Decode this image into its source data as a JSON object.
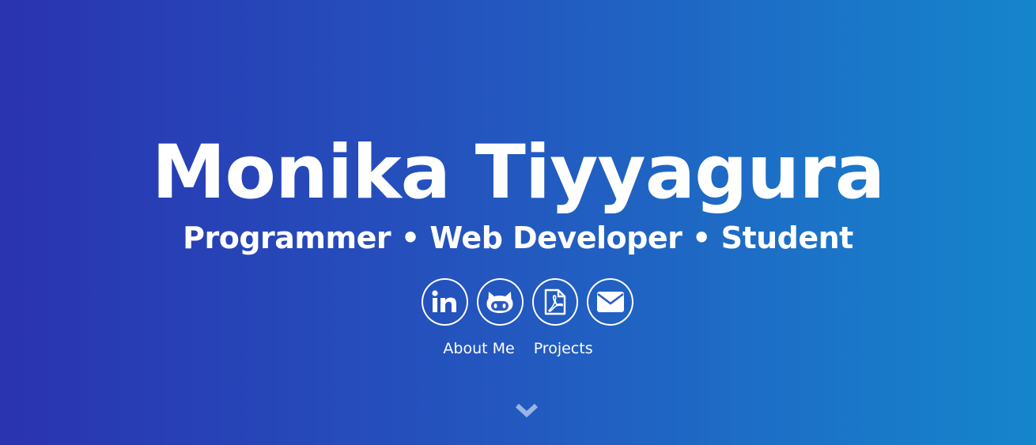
{
  "hero": {
    "name": "Monika Tiyyagura",
    "tagline": "Programmer • Web Developer • Student",
    "background_colors": [
      "#2a33b0",
      "#1585cc"
    ]
  },
  "social_links": [
    {
      "icon": "linkedin-icon"
    },
    {
      "icon": "github-icon"
    },
    {
      "icon": "pdf-resume-icon"
    },
    {
      "icon": "email-icon"
    }
  ],
  "nav": {
    "about_label": "About Me",
    "projects_label": "Projects"
  },
  "scroll": {
    "icon": "chevron-down-icon"
  }
}
